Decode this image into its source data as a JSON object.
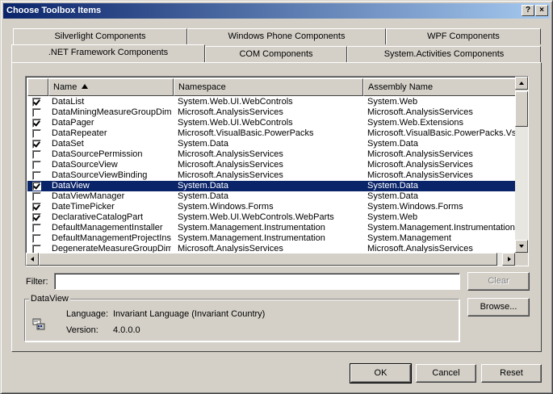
{
  "window": {
    "title": "Choose Toolbox Items",
    "help_glyph": "?",
    "close_glyph": "×"
  },
  "tabs": {
    "row_back": [
      {
        "label": "Silverlight Components"
      },
      {
        "label": "Windows Phone Components"
      },
      {
        "label": "WPF Components"
      }
    ],
    "row_front": [
      {
        "label": ".NET Framework Components",
        "active": true
      },
      {
        "label": "COM Components"
      },
      {
        "label": "System.Activities Components"
      }
    ]
  },
  "list": {
    "columns": [
      {
        "label": ""
      },
      {
        "label": "Name"
      },
      {
        "label": "Namespace"
      },
      {
        "label": "Assembly Name"
      }
    ],
    "rows": [
      {
        "checked": true,
        "name": "DataList",
        "namespace": "System.Web.UI.WebControls",
        "assembly": "System.Web",
        "selected": false
      },
      {
        "checked": false,
        "name": "DataMiningMeasureGroupDime",
        "namespace": "Microsoft.AnalysisServices",
        "assembly": "Microsoft.AnalysisServices",
        "selected": false
      },
      {
        "checked": true,
        "name": "DataPager",
        "namespace": "System.Web.UI.WebControls",
        "assembly": "System.Web.Extensions",
        "selected": false
      },
      {
        "checked": false,
        "name": "DataRepeater",
        "namespace": "Microsoft.VisualBasic.PowerPacks",
        "assembly": "Microsoft.VisualBasic.PowerPacks.Vs",
        "selected": false
      },
      {
        "checked": true,
        "name": "DataSet",
        "namespace": "System.Data",
        "assembly": "System.Data",
        "selected": false
      },
      {
        "checked": false,
        "name": "DataSourcePermission",
        "namespace": "Microsoft.AnalysisServices",
        "assembly": "Microsoft.AnalysisServices",
        "selected": false
      },
      {
        "checked": false,
        "name": "DataSourceView",
        "namespace": "Microsoft.AnalysisServices",
        "assembly": "Microsoft.AnalysisServices",
        "selected": false
      },
      {
        "checked": false,
        "name": "DataSourceViewBinding",
        "namespace": "Microsoft.AnalysisServices",
        "assembly": "Microsoft.AnalysisServices",
        "selected": false
      },
      {
        "checked": true,
        "name": "DataView",
        "namespace": "System.Data",
        "assembly": "System.Data",
        "selected": true
      },
      {
        "checked": false,
        "name": "DataViewManager",
        "namespace": "System.Data",
        "assembly": "System.Data",
        "selected": false
      },
      {
        "checked": true,
        "name": "DateTimePicker",
        "namespace": "System.Windows.Forms",
        "assembly": "System.Windows.Forms",
        "selected": false
      },
      {
        "checked": true,
        "name": "DeclarativeCatalogPart",
        "namespace": "System.Web.UI.WebControls.WebParts",
        "assembly": "System.Web",
        "selected": false
      },
      {
        "checked": false,
        "name": "DefaultManagementInstaller",
        "namespace": "System.Management.Instrumentation",
        "assembly": "System.Management.Instrumentation",
        "selected": false
      },
      {
        "checked": false,
        "name": "DefaultManagementProjectIns",
        "namespace": "System.Management.Instrumentation",
        "assembly": "System.Management",
        "selected": false
      },
      {
        "checked": false,
        "name": "DegenerateMeasureGroupDim",
        "namespace": "Microsoft.AnalysisServices",
        "assembly": "Microsoft.AnalysisServices",
        "selected": false
      }
    ]
  },
  "filter": {
    "label": "Filter:",
    "value": "",
    "clear_label": "Clear"
  },
  "details": {
    "group_title": "DataView",
    "language_label": "Language:",
    "language_value": "Invariant Language (Invariant Country)",
    "version_label": "Version:",
    "version_value": "4.0.0.0",
    "browse_label": "Browse...",
    "icon": "component-icon"
  },
  "buttons": {
    "ok_label": "OK",
    "cancel_label": "Cancel",
    "reset_label": "Reset"
  },
  "colors": {
    "titlebar_start": "#0a246a",
    "titlebar_end": "#a6caf0",
    "selection": "#0a246a",
    "face": "#d4d0c8"
  }
}
